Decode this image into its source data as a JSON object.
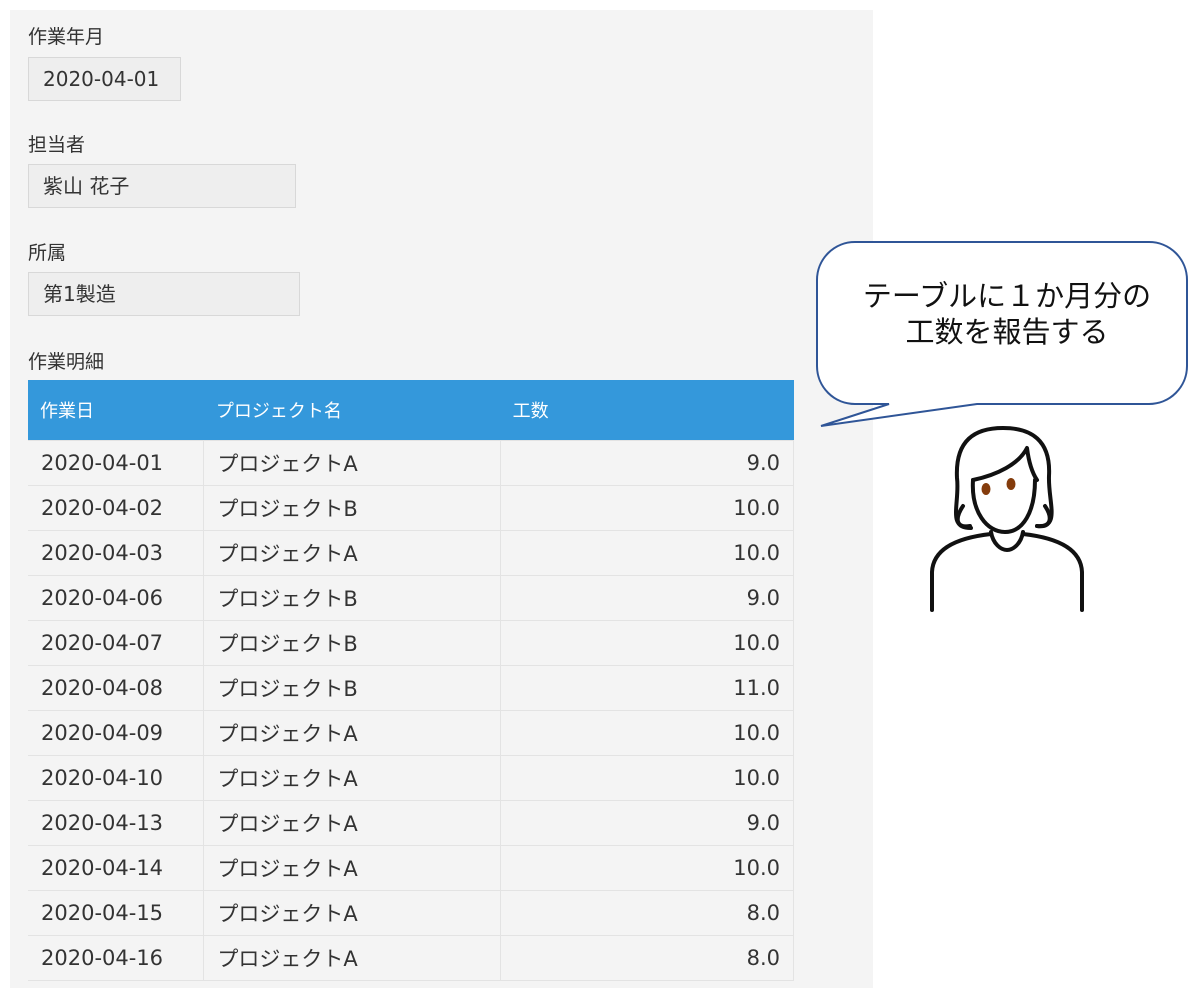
{
  "form": {
    "work_month": {
      "label": "作業年月",
      "value": "2020-04-01"
    },
    "assignee": {
      "label": "担当者",
      "value": "紫山 花子"
    },
    "department": {
      "label": "所属",
      "value": "第1製造"
    },
    "details_label": "作業明細"
  },
  "table": {
    "headers": [
      "作業日",
      "プロジェクト名",
      "工数"
    ],
    "rows": [
      [
        "2020-04-01",
        "プロジェクトA",
        "9.0"
      ],
      [
        "2020-04-02",
        "プロジェクトB",
        "10.0"
      ],
      [
        "2020-04-03",
        "プロジェクトA",
        "10.0"
      ],
      [
        "2020-04-06",
        "プロジェクトB",
        "9.0"
      ],
      [
        "2020-04-07",
        "プロジェクトB",
        "10.0"
      ],
      [
        "2020-04-08",
        "プロジェクトB",
        "11.0"
      ],
      [
        "2020-04-09",
        "プロジェクトA",
        "10.0"
      ],
      [
        "2020-04-10",
        "プロジェクトA",
        "10.0"
      ],
      [
        "2020-04-13",
        "プロジェクトA",
        "9.0"
      ],
      [
        "2020-04-14",
        "プロジェクトA",
        "10.0"
      ],
      [
        "2020-04-15",
        "プロジェクトA",
        "8.0"
      ],
      [
        "2020-04-16",
        "プロジェクトA",
        "8.0"
      ]
    ]
  },
  "callout": {
    "line1": "テーブルに１か月分の",
    "line2": "工数を報告する"
  },
  "colors": {
    "header_bg": "#3498db",
    "panel_bg": "#f4f4f4",
    "bubble_border": "#2f5597"
  },
  "icons": {
    "person": "person-illustration"
  }
}
